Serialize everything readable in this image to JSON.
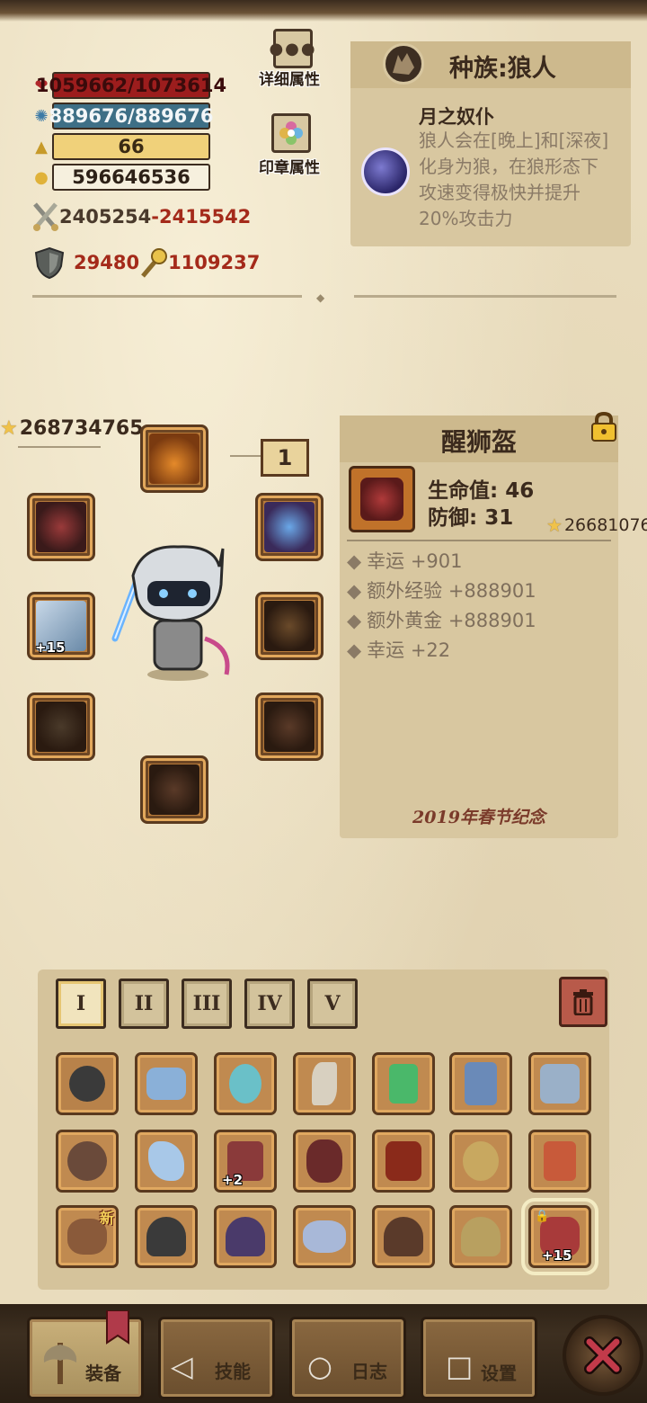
{
  "stats": {
    "hp": "1059662/1073614",
    "mp": "889676/889676",
    "level": "66",
    "gold": "596646536",
    "attack_min": "2405254",
    "attack_sep": "-",
    "attack_max": "2415542",
    "defense": "29480",
    "magic": "1109237"
  },
  "buttons": {
    "detail_attributes": "详细属性",
    "seal_attributes": "印章属性"
  },
  "race": {
    "title": "种族:狼人",
    "trait_name": "月之奴仆",
    "trait_desc": "狼人会在[晚上]和[深夜]化身为狼，在狼形态下攻速变得极快并提升20%攻击力"
  },
  "equipment": {
    "total_score": "268734765",
    "level_box": "1",
    "weapon_plus": "+15"
  },
  "item": {
    "name": "醒狮盔",
    "stat_hp": "生命值: 46",
    "stat_def": "防御: 31",
    "score": "26681076",
    "affixes": [
      "幸运 +901",
      "额外经验 +888901",
      "额外黄金 +888901",
      "幸运 +22"
    ],
    "footer": "2019年春节纪念"
  },
  "inventory": {
    "tabs": [
      "I",
      "II",
      "III",
      "IV",
      "V"
    ],
    "active_tab": 0,
    "badge_new": "新",
    "plus_2": "+2",
    "plus_15": "+15"
  },
  "nav": {
    "equip": "装备",
    "skill": "技能",
    "log": "日志",
    "settings": "设置"
  },
  "colors": {
    "background": "#e9dcbd",
    "hp_bar": "#9c1d1d",
    "mp_bar": "#3e6f86",
    "level_bar": "#f0d17a",
    "accent_red": "#a42a1a"
  }
}
